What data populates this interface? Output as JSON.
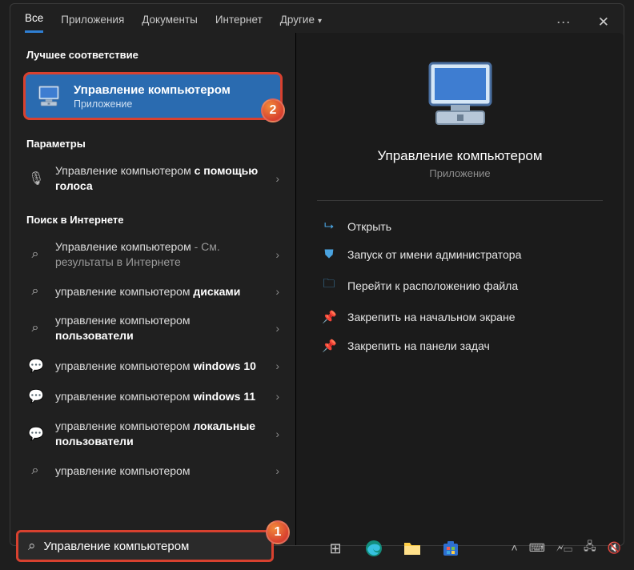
{
  "tabs": {
    "items": [
      "Все",
      "Приложения",
      "Документы",
      "Интернет",
      "Другие"
    ],
    "active_index": 0
  },
  "sections": {
    "best_match": "Лучшее соответствие",
    "settings": "Параметры",
    "web": "Поиск в Интернете"
  },
  "best_match": {
    "title": "Управление компьютером",
    "subtitle": "Приложение"
  },
  "settings_results": [
    {
      "prefix": "Управление компьютером ",
      "bold": "с помощью голоса",
      "suffix": "",
      "icon": "mic"
    }
  ],
  "web_results": [
    {
      "prefix": "Управление компьютером",
      "bold": "",
      "suffix": " - См. результаты в Интернете",
      "icon": "search"
    },
    {
      "prefix": "управление компьютером ",
      "bold": "дисками",
      "suffix": "",
      "icon": "search"
    },
    {
      "prefix": "управление компьютером ",
      "bold": "пользователи",
      "suffix": "",
      "icon": "search"
    },
    {
      "prefix": "управление компьютером ",
      "bold": "windows 10",
      "suffix": "",
      "icon": "chat"
    },
    {
      "prefix": "управление компьютером ",
      "bold": "windows 11",
      "suffix": "",
      "icon": "chat"
    },
    {
      "prefix": "управление компьютером ",
      "bold": "локальные пользователи",
      "suffix": "",
      "icon": "chat"
    },
    {
      "prefix": "управление компьютером ",
      "bold": "",
      "suffix": "",
      "icon": "search"
    }
  ],
  "detail": {
    "title": "Управление компьютером",
    "subtitle": "Приложение",
    "actions": [
      {
        "icon": "open",
        "label": "Открыть"
      },
      {
        "icon": "admin",
        "label": "Запуск от имени администратора"
      },
      {
        "icon": "folder",
        "label": "Перейти к расположению файла"
      },
      {
        "icon": "pin-start",
        "label": "Закрепить на начальном экране"
      },
      {
        "icon": "pin-task",
        "label": "Закрепить на панели задач"
      }
    ]
  },
  "search": {
    "value": "Управление компьютером"
  },
  "annotations": {
    "badge1": "1",
    "badge2": "2"
  },
  "taskbar": {
    "icons": [
      "task-view",
      "edge",
      "explorer",
      "store"
    ]
  },
  "tray": {
    "items": [
      "chevron-up",
      "keyboard",
      "battery",
      "network",
      "volume"
    ]
  }
}
